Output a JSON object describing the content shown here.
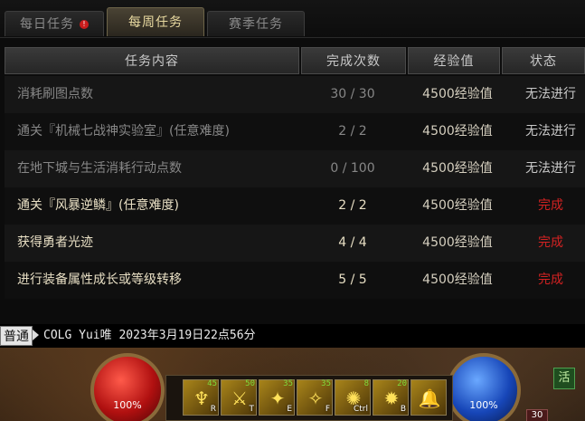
{
  "tabs": [
    {
      "label": "每日任务",
      "alert": "!"
    },
    {
      "label": "每周任务"
    },
    {
      "label": "赛季任务"
    }
  ],
  "table": {
    "headers": [
      "任务内容",
      "完成次数",
      "经验值",
      "状态"
    ],
    "rows": [
      {
        "name": "消耗刷图点数",
        "count": "30 / 30",
        "exp": "4500经验值",
        "status": "无法进行"
      },
      {
        "name": "通关『机械七战神实验室』(任意难度)",
        "count": "2 / 2",
        "exp": "4500经验值",
        "status": "无法进行"
      },
      {
        "name": "在地下城与生活消耗行动点数",
        "count": "0 / 100",
        "exp": "4500经验值",
        "status": "无法进行"
      },
      {
        "name": "通关『风暴逆鳞』(任意难度)",
        "count": "2 / 2",
        "exp": "4500经验值",
        "status": "完成"
      },
      {
        "name": "获得勇者光迹",
        "count": "4 / 4",
        "exp": "4500经验值",
        "status": "完成"
      },
      {
        "name": "进行装备属性成长或等级转移",
        "count": "5 / 5",
        "exp": "4500经验值",
        "status": "完成"
      }
    ]
  },
  "chat": {
    "channel": "普通",
    "message": "COLG Yui唯 2023年3月19日22点56分"
  },
  "hud": {
    "hp_label": "100%",
    "mp_label": "100%",
    "side_button": "活",
    "corner_number": "30",
    "skills": [
      {
        "icon": "figure-skill-icon",
        "level": "45",
        "key": "R"
      },
      {
        "icon": "slash-skill-icon",
        "level": "50",
        "key": "T"
      },
      {
        "icon": "beast-skill-icon",
        "level": "35",
        "key": "E"
      },
      {
        "icon": "claw-skill-icon",
        "level": "35",
        "key": "F"
      },
      {
        "icon": "sun-skill-icon",
        "level": "8",
        "key": "Ctrl"
      },
      {
        "icon": "star-skill-icon",
        "level": "20",
        "key": "B"
      },
      {
        "icon": "bell-skill-icon",
        "level": "",
        "key": ""
      }
    ]
  },
  "colors": {
    "completed_status": "#d32222",
    "blocked_status": "#c9c9c9",
    "active_tab_text": "#e8d9a0"
  }
}
